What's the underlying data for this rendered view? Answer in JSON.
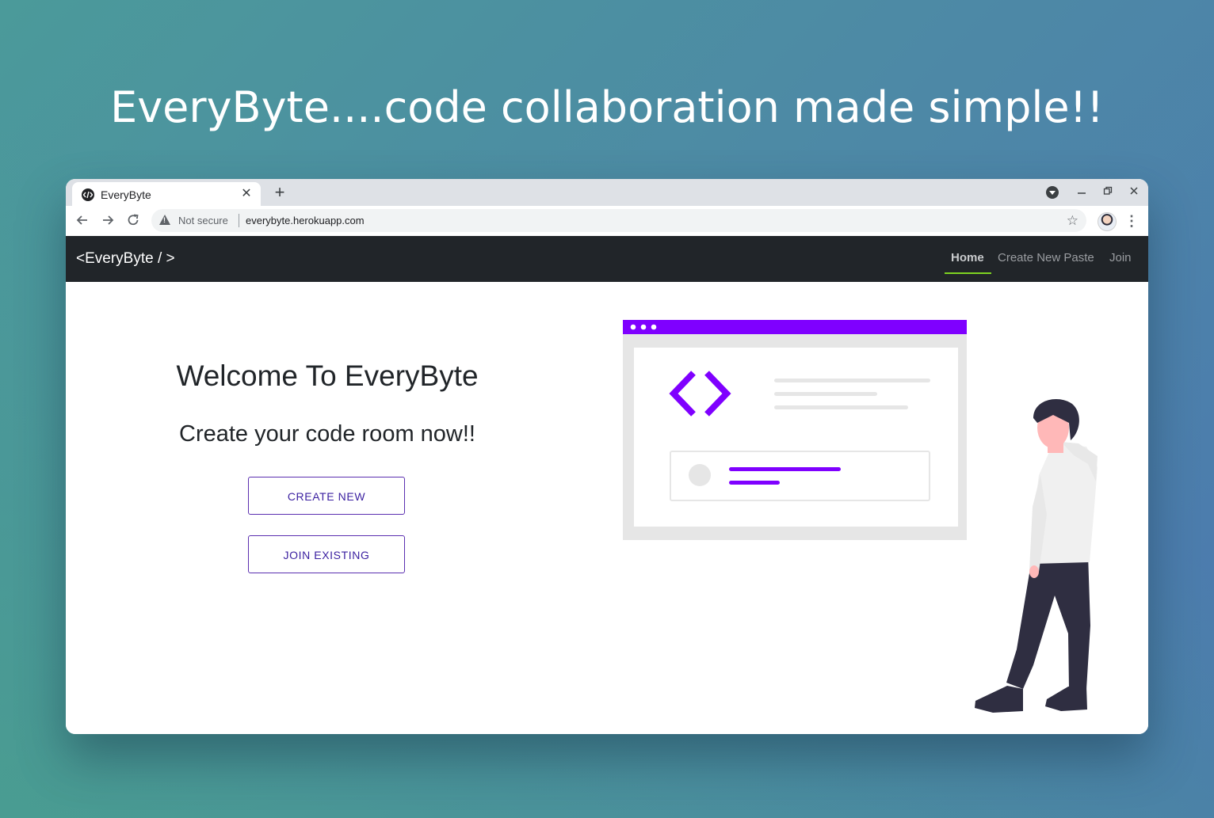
{
  "headline": "EveryByte....code collaboration made simple!!",
  "browser": {
    "tab_title": "EveryByte",
    "tab_close": "✕",
    "new_tab": "+",
    "not_secure": "Not secure",
    "url": "everybyte.herokuapp.com",
    "back_icon": "arrow-left-icon",
    "forward_icon": "arrow-right-icon",
    "reload_icon": "reload-icon",
    "star_icon": "star-icon"
  },
  "navbar": {
    "brand": "<EveryByte / >",
    "links": [
      "Home",
      "Create New Paste",
      "Join"
    ],
    "active": "Home",
    "accent": "#7ed321"
  },
  "main": {
    "welcome": "Welcome To EveryByte",
    "subtitle": "Create your code room now!!",
    "create_button": "CREATE NEW",
    "join_button": "JOIN EXISTING"
  },
  "colors": {
    "illustration_purple": "#7f00ff",
    "button_border": "#5b2fb0",
    "navbar_bg": "#212529"
  }
}
